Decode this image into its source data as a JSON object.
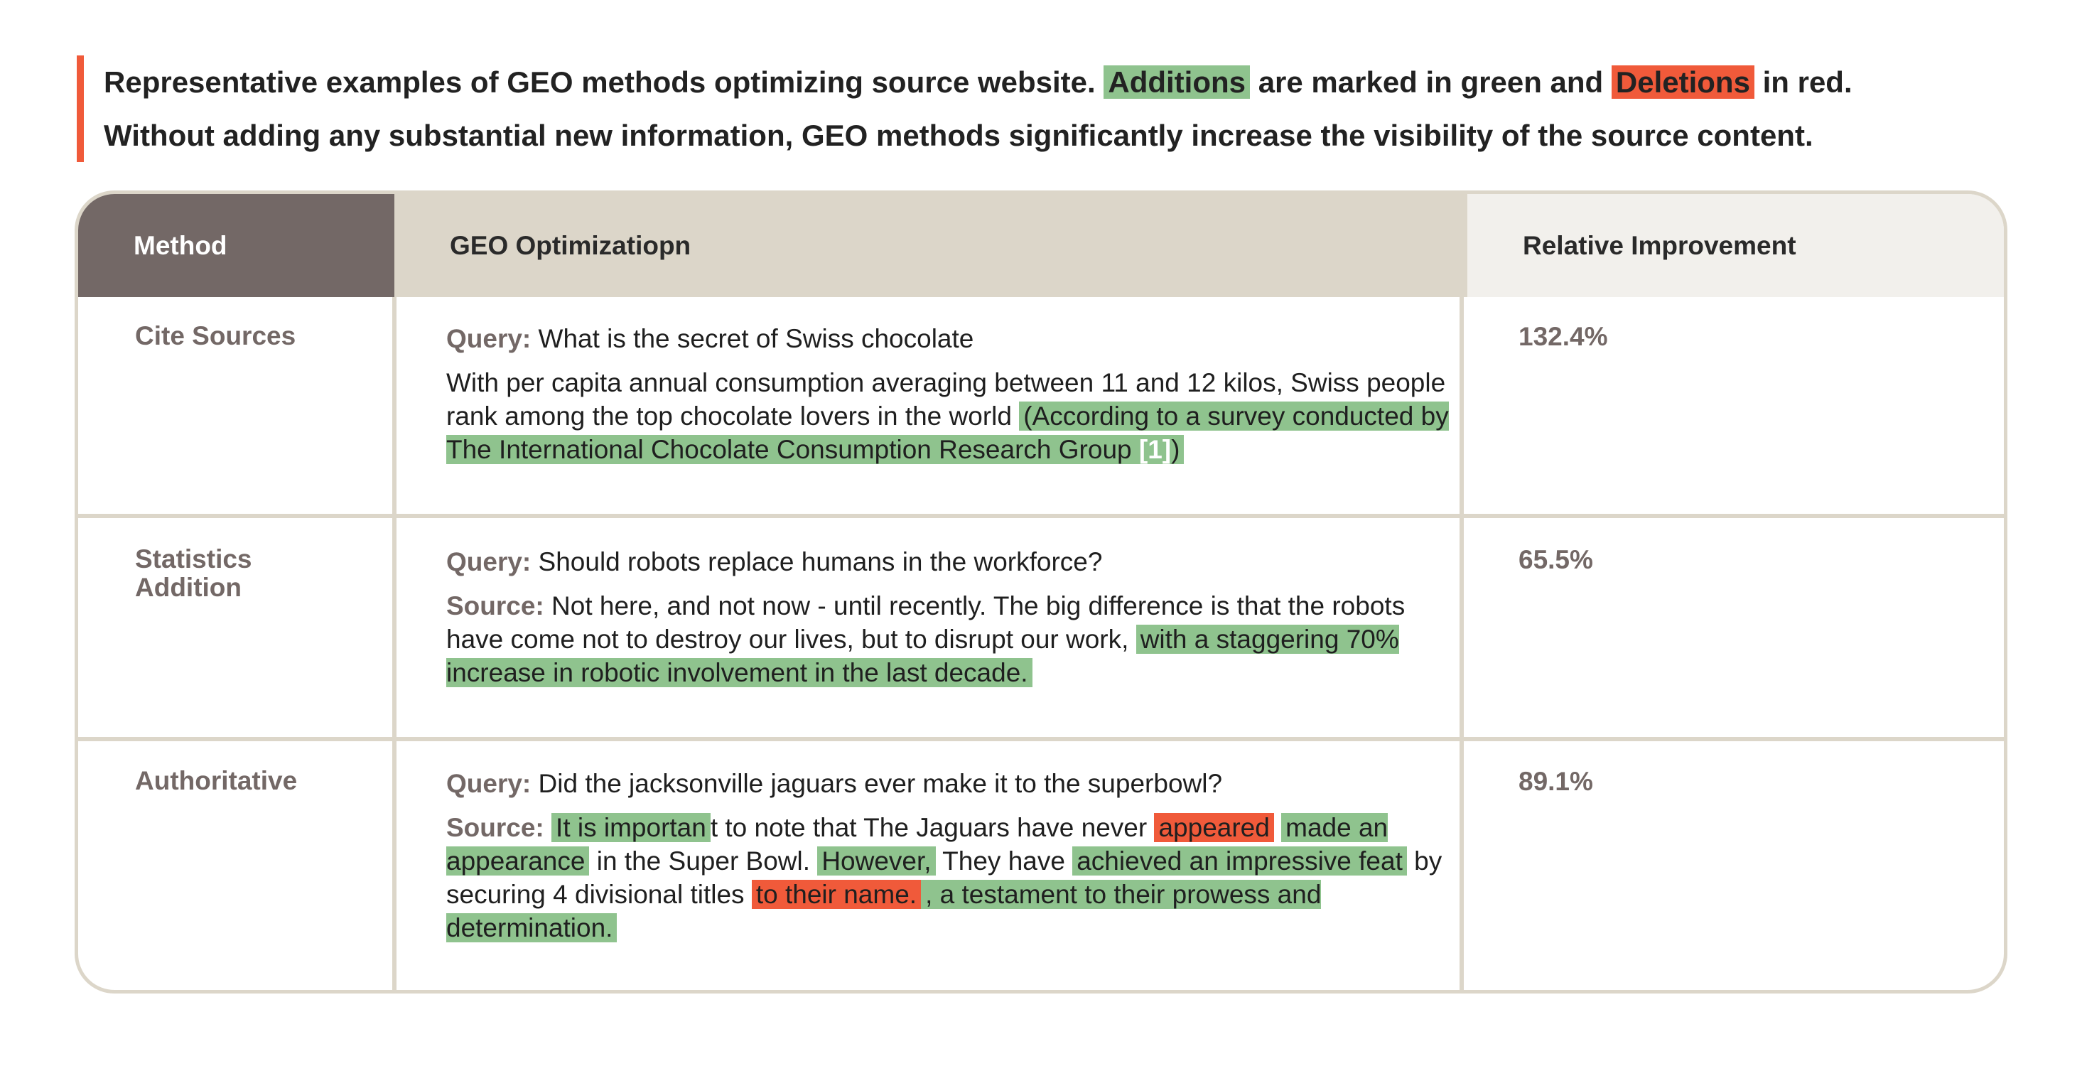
{
  "caption": {
    "line1_a": "Representative examples of GEO methods optimizing source website.",
    "additions_word": "Additions",
    "line1_b": "are marked in green and",
    "deletions_word": "Deletions",
    "line1_c": "in red.",
    "line2": "Without adding any substantial new information, GEO methods significantly increase the visibility of the source content."
  },
  "colors": {
    "accent": "#f05a3a",
    "addition": "#8fc38e",
    "deletion": "#f05a3a",
    "method_header": "#736866",
    "geo_header": "#dcd6c9",
    "rel_header": "#f2f0ec",
    "border": "#dcd6c9"
  },
  "table": {
    "headers": {
      "method": "Method",
      "geo": "GEO Optimizatiopn",
      "relative": "Relative Improvement"
    },
    "rows": [
      {
        "method": "Cite Sources",
        "query_label": "Query:",
        "query": "What is the secret of Swiss chocolate",
        "text_plain": "With per capita annual consumption averaging between 11 and 12 kilos, Swiss people rank among the top chocolate lovers in the world",
        "text_add_a": "(According to a survey conducted by The International Chocolate Consumption Research Group",
        "text_add_cite": "[1]",
        "text_add_b": ")",
        "improvement": "132.4%"
      },
      {
        "method_line1": "Statistics",
        "method_line2": "Addition",
        "query_label": "Query:",
        "query": "Should robots replace humans in the workforce?",
        "source_label": "Source:",
        "text_plain": "Not here, and not now - until recently. The big difference is that the robots have come not to destroy our lives, but to disrupt our work,",
        "text_add": "with a staggering 70% increase in robotic involvement in the last decade.",
        "improvement": "65.5%"
      },
      {
        "method": "Authoritative",
        "query_label": "Query:",
        "query": "Did the jacksonville jaguars ever make it to the superbowl?",
        "source_label": "Source:",
        "seg1_add": "It is importan",
        "seg2": "t to note that The Jaguars have never",
        "seg3_del": "appeared",
        "seg4_add": "made an appearance",
        "seg5": "in the Super Bowl.",
        "seg6_add": "However,",
        "seg7": "They have",
        "seg8_add": "achieved an impressive feat",
        "seg9": "by securing 4 divisional titles",
        "seg10_del": "to their name.",
        "seg11_add": ", a testament to their prowess and determination.",
        "improvement": "89.1%"
      }
    ]
  }
}
